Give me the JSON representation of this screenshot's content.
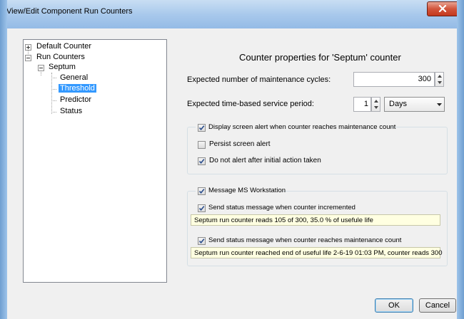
{
  "window": {
    "title": "View/Edit Component Run Counters",
    "close_glyph": "x"
  },
  "tree": {
    "items": [
      {
        "label": "Default Counter",
        "expander": "+"
      },
      {
        "label": "Run Counters",
        "expander": "-"
      },
      {
        "label": "Septum",
        "expander": "-"
      },
      {
        "label": "General"
      },
      {
        "label": "Threshold",
        "selected": true
      },
      {
        "label": "Predictor"
      },
      {
        "label": "Status"
      }
    ]
  },
  "panel": {
    "title": "Counter properties for 'Septum' counter",
    "maintenance_cycles": {
      "label": "Expected number of maintenance cycles:",
      "value": "300"
    },
    "service_period": {
      "label": "Expected time-based service period:",
      "value": "1",
      "unit": "Days"
    },
    "screen_alert": {
      "label": "Display screen alert when counter reaches maintenance count",
      "checked": true,
      "persist": {
        "label": "Persist screen alert",
        "checked": false
      },
      "no_repeat": {
        "label": "Do not alert after initial action taken",
        "checked": true
      }
    },
    "message": {
      "label": "Message MS Workstation",
      "checked": true,
      "incremented": {
        "label": "Send status message when counter incremented",
        "checked": true,
        "text": "Septum run counter reads 105 of 300, 35.0 % of usefule life"
      },
      "reached": {
        "label": "Send status message when counter reaches maintenance count",
        "checked": true,
        "text": "Septum run counter reached end of useful life 2-6-19 01:03 PM, counter reads 300"
      }
    }
  },
  "buttons": {
    "ok": "OK",
    "cancel": "Cancel"
  },
  "colors": {
    "selection": "#3399ff",
    "tooltip_bg": "#ffffe1",
    "titlebar": "#a9c9ec",
    "close": "#c4381d"
  }
}
